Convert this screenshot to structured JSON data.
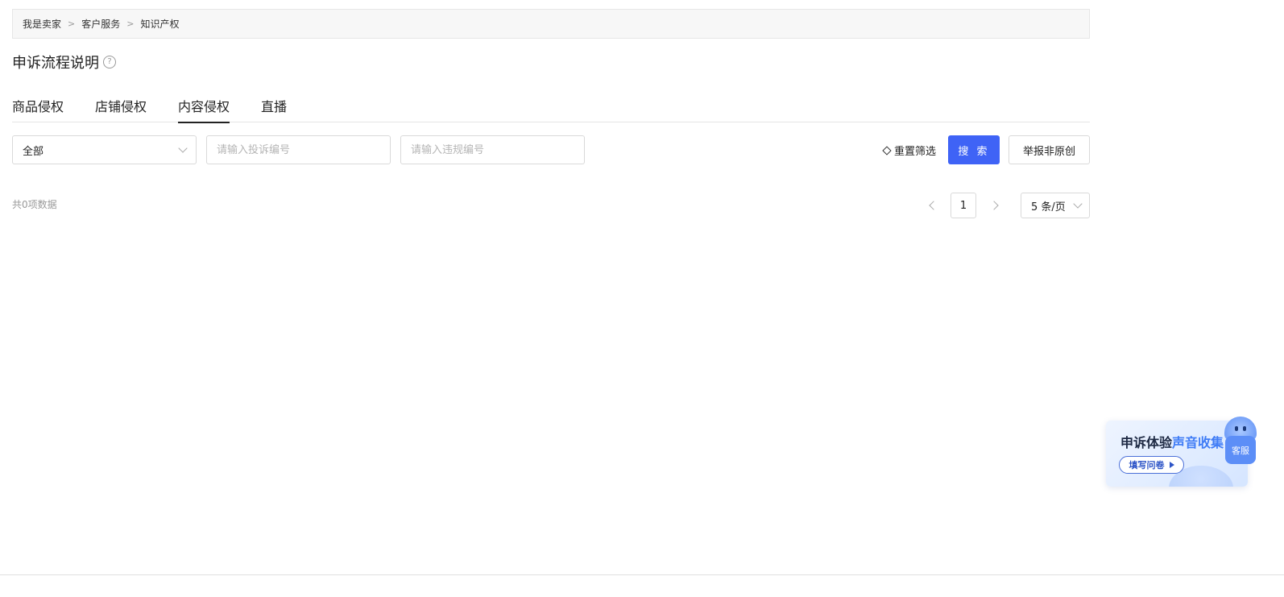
{
  "breadcrumb": {
    "items": [
      "我是卖家",
      "客户服务",
      "知识产权"
    ],
    "separator": ">"
  },
  "page_title": "申诉流程说明",
  "help_icon": "question-circle-icon",
  "tabs": [
    {
      "label": "商品侵权",
      "active": false
    },
    {
      "label": "店铺侵权",
      "active": false
    },
    {
      "label": "内容侵权",
      "active": true
    },
    {
      "label": "直播",
      "active": false
    }
  ],
  "filters": {
    "type_select": {
      "value": "全部",
      "icon": "chevron-down-icon"
    },
    "complaint_no": {
      "placeholder": "请输入投诉编号",
      "value": ""
    },
    "violation_no": {
      "placeholder": "请输入违规编号",
      "value": ""
    },
    "reset_label": "重置筛选",
    "search_label": "搜 索",
    "report_label": "举报非原创"
  },
  "results": {
    "total_text": "共0项数据"
  },
  "pagination": {
    "current_page": "1",
    "page_size": "5 条/页"
  },
  "promo": {
    "title_prefix": "申诉体验",
    "title_highlight": "声音收集",
    "button_label": "填写问卷"
  },
  "customer_service": {
    "label": "客服"
  },
  "colors": {
    "primary": "#3f63f6",
    "text": "#222222",
    "muted": "#999999",
    "border": "#d9d9d9"
  }
}
